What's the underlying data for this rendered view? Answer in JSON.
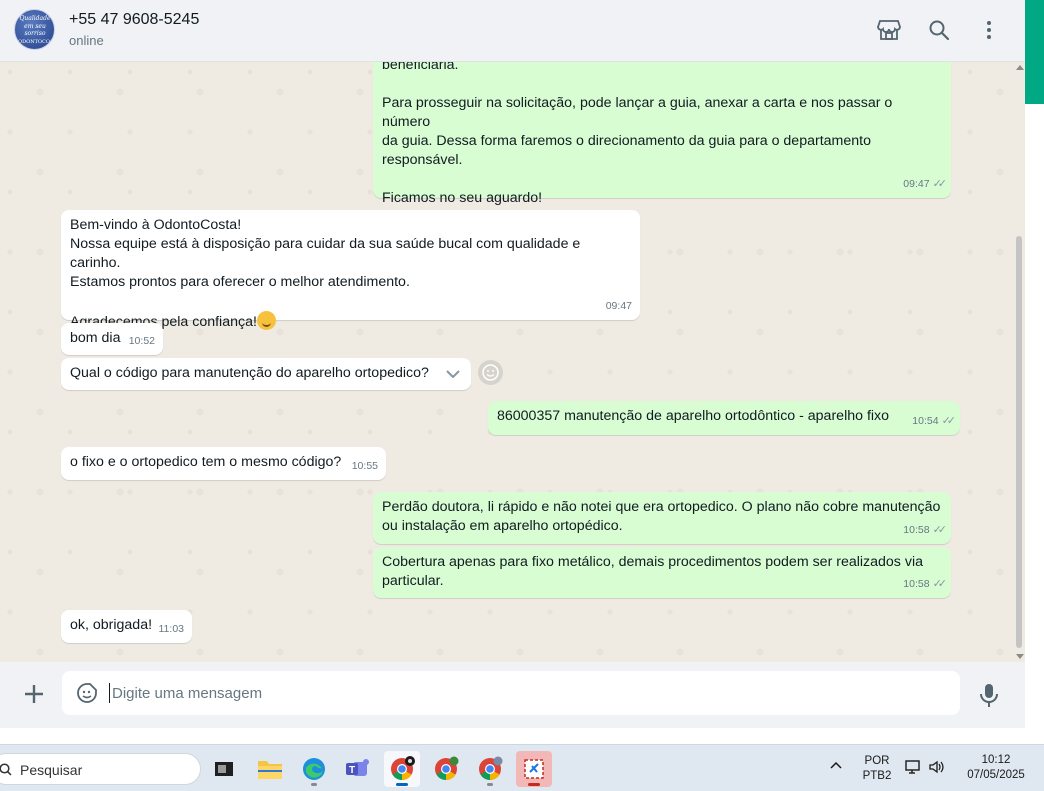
{
  "header": {
    "contact_name": "+55 47 9608-5245",
    "status": "online",
    "avatar_text": [
      "Qualidade",
      "em seu",
      "sorriso",
      "ODONTOCOSTA"
    ]
  },
  "messages": [
    {
      "dir": "out",
      "text": "beneficiária.\n\nPara prosseguir na solicitação, pode lançar a guia, anexar a carta e nos passar o número\nda guia. Dessa forma faremos o direcionamento da guia para o departamento\nresponsável.\n\nFicamos no seu aguardo!",
      "time": "09:47",
      "ticks": "✓✓"
    },
    {
      "dir": "in",
      "text": "Bem-vindo à OdontoCosta!\nNossa equipe está à disposição para cuidar da sua saúde bucal com qualidade e carinho.\nEstamos prontos para oferecer o melhor atendimento.\n\nAgradecemos pela confiança!",
      "time": "09:47"
    },
    {
      "dir": "in",
      "text": "bom dia",
      "time": "10:52"
    },
    {
      "dir": "in",
      "text": "Qual o código para manutenção do aparelho ortopedico?",
      "time": ""
    },
    {
      "dir": "out",
      "text": "86000357 manutenção de aparelho ortodôntico - aparelho fixo",
      "time": "10:54",
      "ticks": "✓✓"
    },
    {
      "dir": "in",
      "text": "o fixo e o ortopedico tem o mesmo código?",
      "time": "10:55"
    },
    {
      "dir": "out",
      "text": "Perdão doutora, li rápido e não notei que era ortopedico. O plano não cobre manutenção\nou instalação em aparelho ortopédico.",
      "time": "10:58",
      "ticks": "✓✓"
    },
    {
      "dir": "out",
      "text": "Cobertura apenas para fixo metálico, demais procedimentos podem ser realizados via\nparticular.",
      "time": "10:58",
      "ticks": "✓✓"
    },
    {
      "dir": "in",
      "text": "ok, obrigada!",
      "time": "11:03"
    }
  ],
  "composer": {
    "placeholder": "Digite uma mensagem"
  },
  "taskbar": {
    "search_label": "Pesquisar",
    "lang_line1": "POR",
    "lang_line2": "PTB2",
    "time": "10:12",
    "date": "07/05/2025"
  },
  "colors": {
    "outgoing_bubble": "#d9fdd3",
    "incoming_bubble": "#ffffff",
    "accent": "#00a884",
    "chat_background": "#efeae2"
  },
  "icons": [
    "store-icon",
    "search-icon",
    "menu-dots-icon",
    "plus-icon",
    "sticker-icon",
    "mic-icon",
    "emoji-react-icon",
    "chevron-down-icon"
  ]
}
